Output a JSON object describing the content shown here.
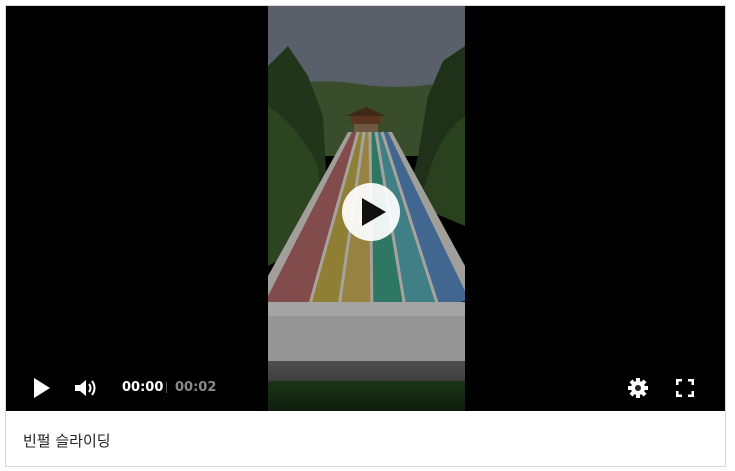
{
  "player": {
    "current_time": "00:00",
    "total_time": "00:02",
    "progress": 0,
    "icons": {
      "play": "play-icon",
      "volume": "volume-icon",
      "settings": "gear-icon",
      "fullscreen": "fullscreen-icon",
      "big_play": "big-play-icon"
    },
    "thumbnail_alt": "rainbow water slide video frame"
  },
  "caption": {
    "text": "빈펄 슬라이딩"
  },
  "colors": {
    "player_bg": "#000000",
    "control_text": "#ffffff",
    "control_muted": "#8a8a8a",
    "caption_text": "#222222"
  }
}
